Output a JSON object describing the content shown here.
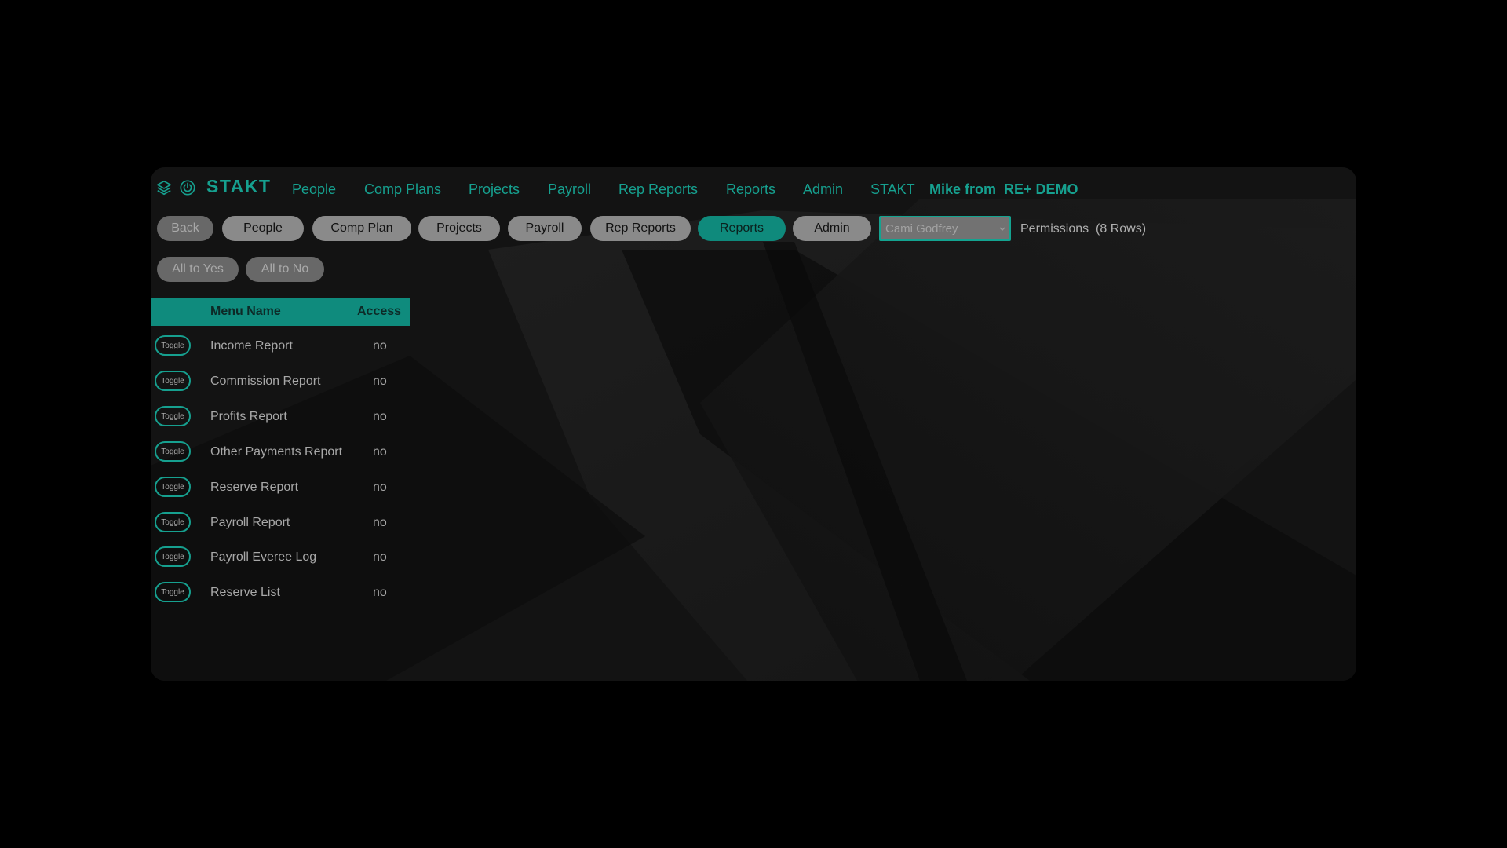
{
  "brand": {
    "name": "STAKT",
    "accent": "#16a08f"
  },
  "nav": {
    "links": [
      "People",
      "Comp Plans",
      "Projects",
      "Payroll",
      "Rep Reports",
      "Reports",
      "Admin",
      "STAKT"
    ],
    "user": "Mike from  RE+ DEMO",
    "icons": [
      "layers-icon",
      "power-icon"
    ]
  },
  "toolbar": {
    "buttons": [
      "Back",
      "People",
      "Comp Plan",
      "Projects",
      "Payroll",
      "Rep Reports",
      "Reports",
      "Admin"
    ],
    "active": "Reports",
    "user_select": {
      "value": "Cami Godfrey"
    },
    "permissions_label": "Permissions  (8 Rows)"
  },
  "bulk": {
    "all_yes": "All to Yes",
    "all_no": "All to No"
  },
  "table": {
    "columns": [
      "Menu Name",
      "Access"
    ],
    "toggle_label": "Toggle",
    "rows": [
      {
        "name": "Income Report",
        "access": "no"
      },
      {
        "name": "Commission Report",
        "access": "no"
      },
      {
        "name": "Profits Report",
        "access": "no"
      },
      {
        "name": "Other Payments Report",
        "access": "no"
      },
      {
        "name": "Reserve Report",
        "access": "no"
      },
      {
        "name": "Payroll Report",
        "access": "no"
      },
      {
        "name": "Payroll Everee Log",
        "access": "no"
      },
      {
        "name": "Reserve List",
        "access": "no"
      }
    ]
  }
}
